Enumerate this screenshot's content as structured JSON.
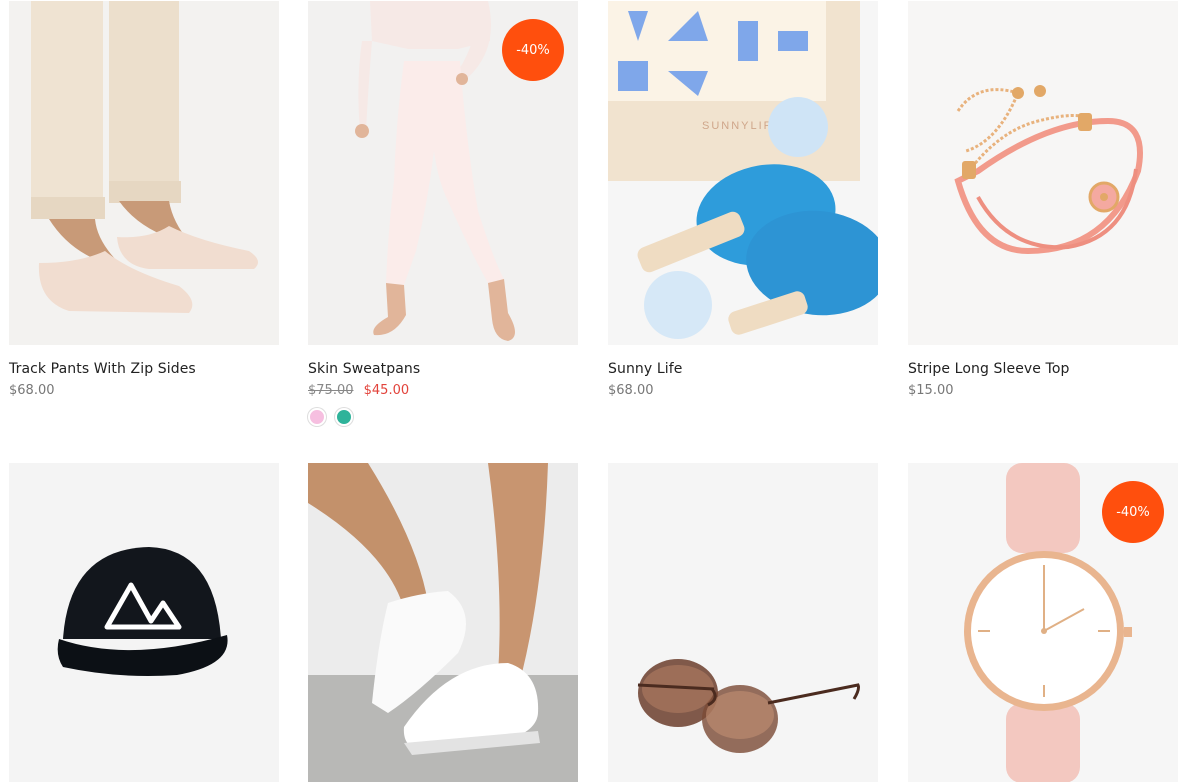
{
  "products": [
    {
      "name": "Track Pants With Zip Sides",
      "price": "$68.00"
    },
    {
      "name": "Skin Sweatpans",
      "old_price": "$75.00",
      "price": "$45.00",
      "badge": "-40%",
      "swatches": [
        "#f6bfe0",
        "#2fb39a"
      ]
    },
    {
      "name": "Sunny Life",
      "price": "$68.00",
      "brand_print": "SUNNYLIFE"
    },
    {
      "name": "Stripe Long Sleeve Top",
      "price": "$15.00"
    },
    {
      "name": "",
      "price": ""
    },
    {
      "name": "",
      "price": ""
    },
    {
      "name": "",
      "price": ""
    },
    {
      "name": "",
      "price": "",
      "badge": "-40%"
    }
  ]
}
